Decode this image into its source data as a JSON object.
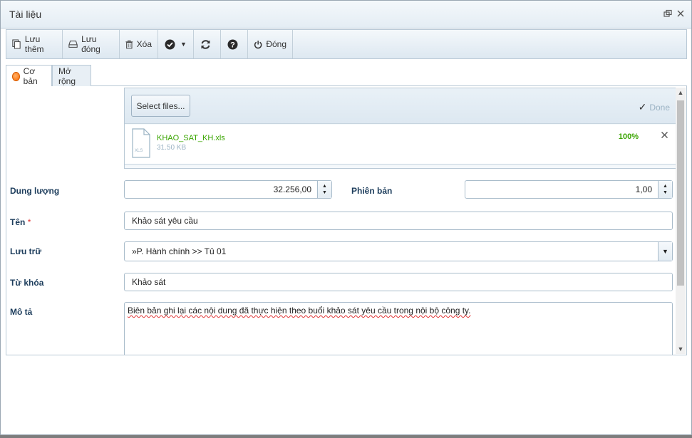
{
  "window": {
    "title": "Tài liệu"
  },
  "toolbar": {
    "save_more": "Lưu thêm",
    "save_close": "Lưu đóng",
    "delete": "Xóa",
    "close": "Đóng"
  },
  "tabs": [
    {
      "label": "Cơ bản",
      "active": true
    },
    {
      "label": "Mở rộng",
      "active": false
    }
  ],
  "upload": {
    "select_label": "Select files...",
    "done_label": "Done",
    "file": {
      "name": "KHAO_SAT_KH.xls",
      "size": "31.50 KB",
      "progress": "100%",
      "ext": "XLS"
    }
  },
  "form": {
    "capacity": {
      "label": "Dung lượng",
      "value": "32.256,00"
    },
    "version": {
      "label": "Phiên bản",
      "value": "1,00"
    },
    "name": {
      "label": "Tên",
      "required_mark": "*",
      "value": "Khảo sát yêu cầu"
    },
    "storage": {
      "label": "Lưu trữ",
      "value": "»P. Hành chính >> Tủ 01"
    },
    "keywords": {
      "label": "Từ khóa",
      "value": "Khảo sát"
    },
    "description": {
      "label": "Mô tả",
      "value": "Biên bản ghi lại các nội dung đã thực hiện theo buổi khảo sát yêu cầu trong nội bộ công ty."
    }
  },
  "colors": {
    "accent": "#1d3d5c",
    "success": "#3aa500",
    "border": "#a9bccb"
  }
}
